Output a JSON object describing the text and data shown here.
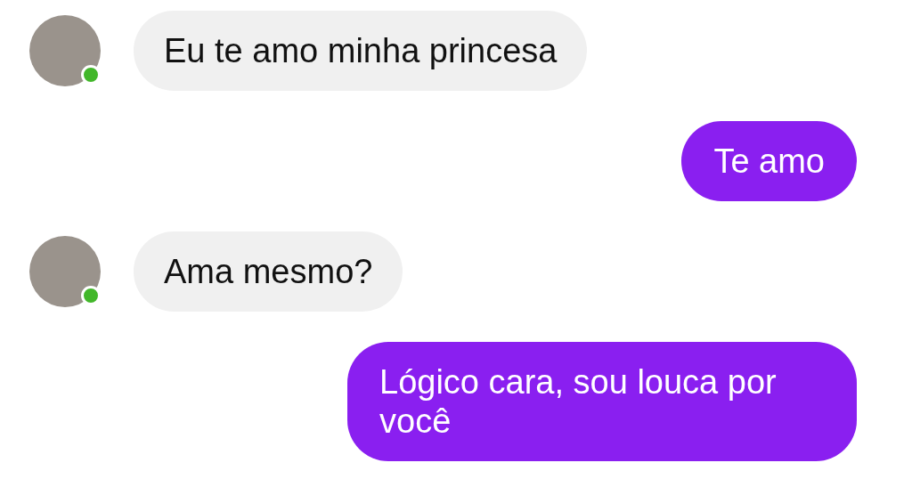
{
  "messages": [
    {
      "kind": "incoming",
      "text": "Eu te amo minha princesa",
      "online": true
    },
    {
      "kind": "outgoing",
      "text": "Te amo"
    },
    {
      "kind": "incoming",
      "text": "Ama mesmo?",
      "online": true
    },
    {
      "kind": "outgoing",
      "text": "Lógico cara, sou louca por você"
    }
  ]
}
